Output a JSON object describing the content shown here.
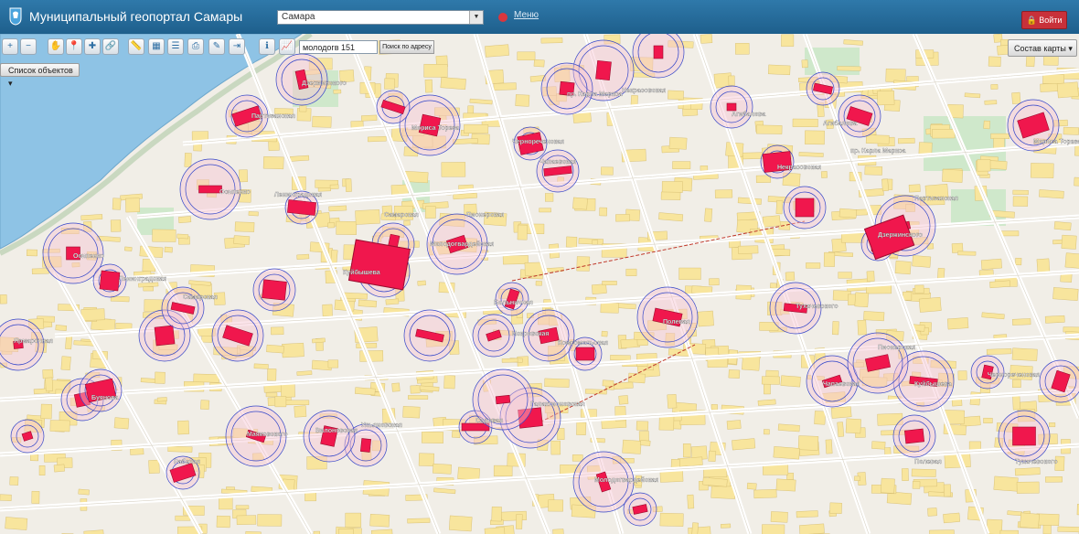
{
  "header": {
    "title": "Муниципальный геопортал Самары",
    "city_select_value": "Самара",
    "menu_label": "Меню",
    "login_label": "Войти"
  },
  "toolbar": {
    "search_value": "молодогв 151",
    "search_button_label": "Поиск по адресу",
    "icons": [
      "zoom-in-icon",
      "zoom-out-icon",
      "pan-hand-icon",
      "marker-icon",
      "add-marker-icon",
      "link-icon",
      "measure-icon",
      "table-icon",
      "legend-icon",
      "print-icon",
      "pencil-icon",
      "export-icon",
      "info-cursor-icon",
      "chart-icon"
    ]
  },
  "panels": {
    "objects_list_label": "Список объектов",
    "map_layers_label": "Состав карты"
  },
  "map": {
    "colors": {
      "water": "#8ec3e5",
      "building": "#f8e59d",
      "object": "#f0174d",
      "buffer_ring": "#3446c9",
      "buffer_fill": "#f7c4d2",
      "park": "#cfe8cb"
    },
    "labels": [
      "Осипенко",
      "Ленинградская",
      "Самарская",
      "Молодогвардейская",
      "Куйбышева",
      "Чернореченская",
      "Чапаевская",
      "Пионерская",
      "Некрасовская",
      "Агибалова",
      "пр. Карла Маркса",
      "Мориса Тореза",
      "Партизанская",
      "Дзержинского",
      "Тухачевского",
      "Полевая",
      "Больничная",
      "Искровская",
      "Комсомольская",
      "Галактионовская",
      "Садовая",
      "Ульяновская",
      "Вилоновская",
      "Маяковского",
      "Рабочая",
      "Буянова",
      "Ярмарочная"
    ]
  }
}
